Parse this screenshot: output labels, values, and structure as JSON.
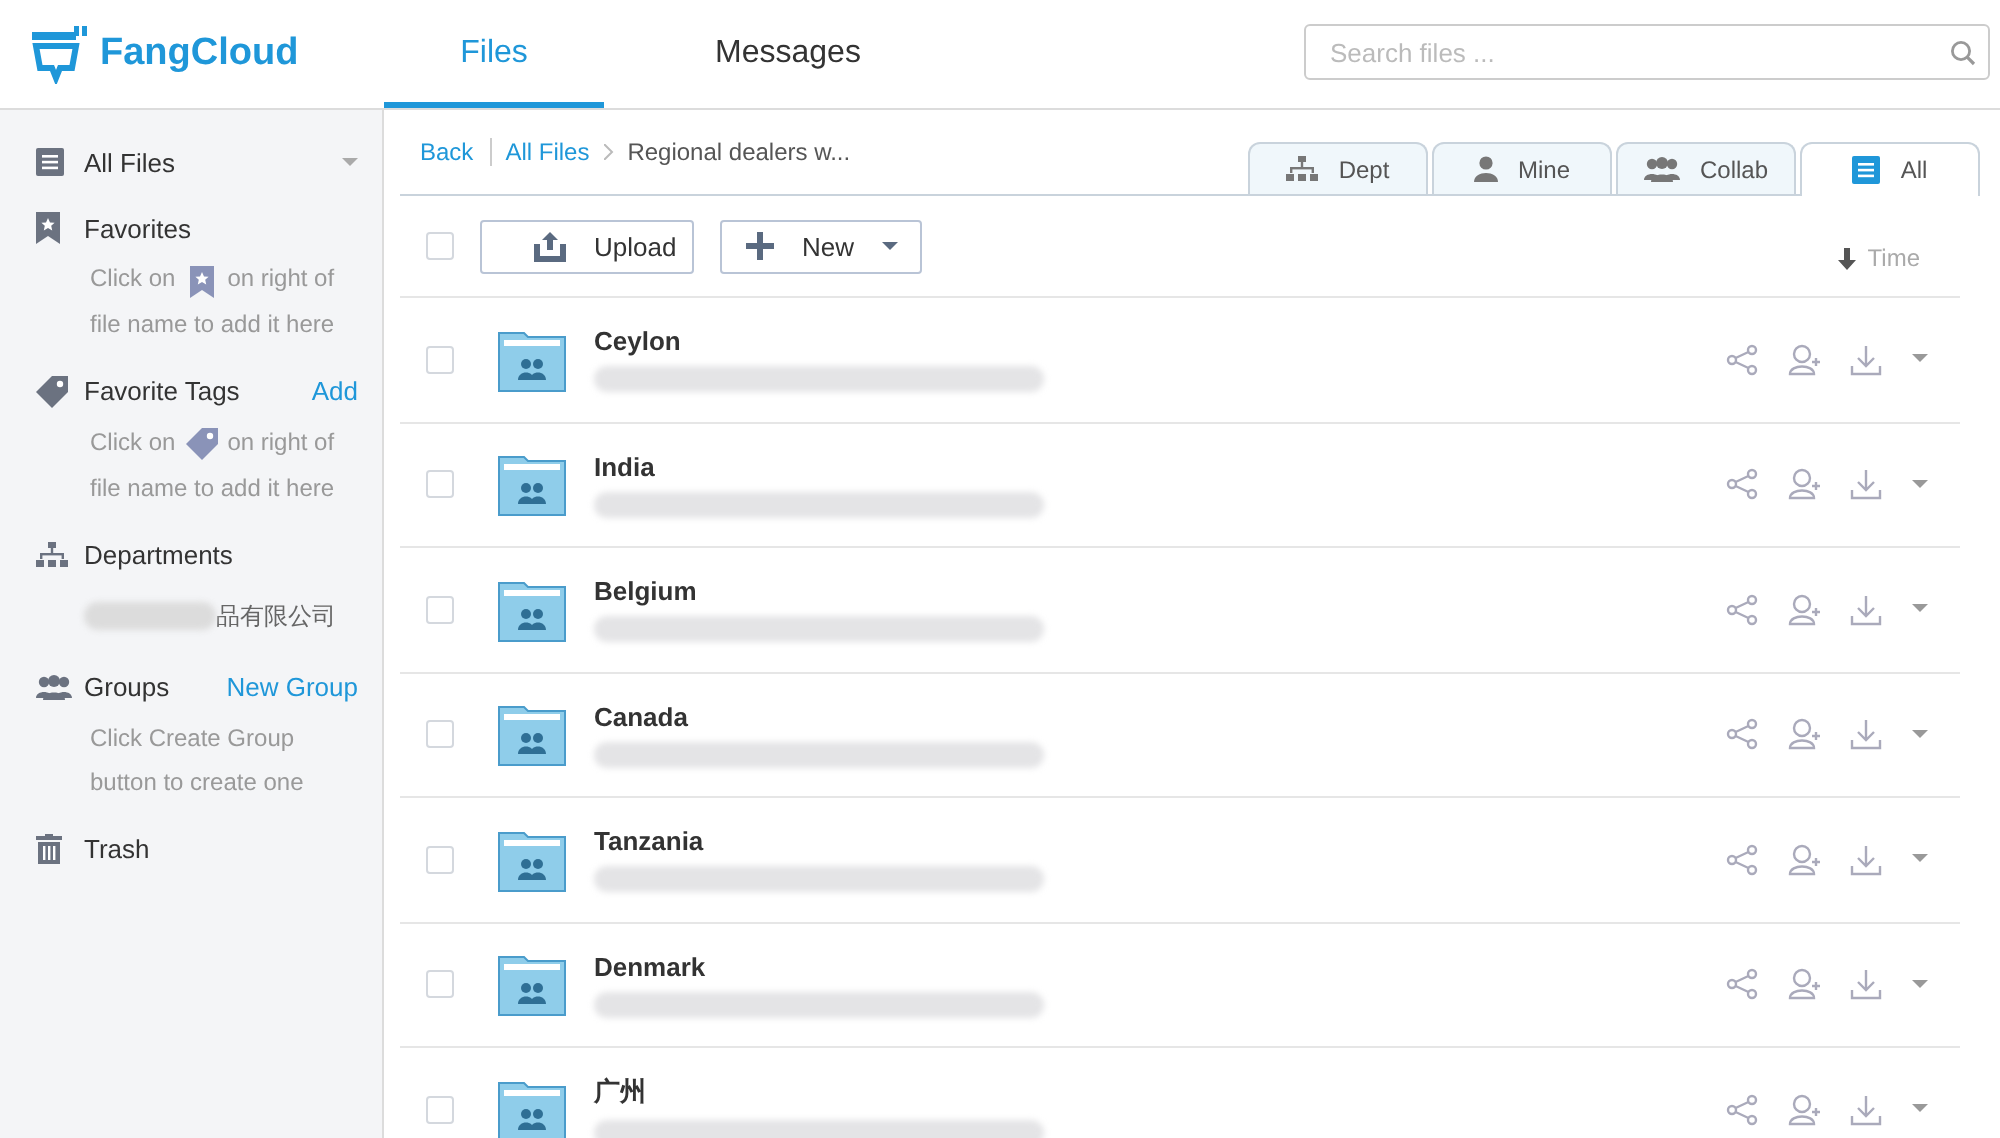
{
  "header": {
    "logo": "FangCloud",
    "tabs": [
      {
        "label": "Files",
        "selected": true
      },
      {
        "label": "Messages",
        "selected": false
      }
    ],
    "search": {
      "placeholder": "Search files ..."
    }
  },
  "sidebar": {
    "items": [
      {
        "label": "All Files"
      },
      {
        "label": "Favorites",
        "hint": {
          "before": "Click on",
          "after": "on right of",
          "line2": "file name to add it here"
        }
      },
      {
        "label": "Favorite Tags",
        "action": "Add",
        "hint": {
          "before": "Click on",
          "after": "on right of",
          "line2": "file name to add it here"
        }
      },
      {
        "label": "Departments",
        "child": "品有限公司"
      },
      {
        "label": "Groups",
        "action": "New Group",
        "hint": {
          "text": "Click Create Group button to create one"
        }
      },
      {
        "label": "Trash"
      }
    ]
  },
  "breadcrumb": {
    "back": "Back",
    "path": [
      "All Files",
      "Regional dealers w..."
    ]
  },
  "view_tabs": [
    {
      "label": "Dept",
      "selected": false
    },
    {
      "label": "Mine",
      "selected": false
    },
    {
      "label": "Collab",
      "selected": false
    },
    {
      "label": "All",
      "selected": true
    }
  ],
  "toolbar": {
    "select_all_checked": false,
    "upload": "Upload",
    "new": "New",
    "sort": "Time"
  },
  "rows": [
    {
      "name": "Ceylon",
      "checked": false
    },
    {
      "name": "India",
      "checked": false
    },
    {
      "name": "Belgium",
      "checked": false
    },
    {
      "name": "Canada",
      "checked": false
    },
    {
      "name": "Tanzania",
      "checked": false
    },
    {
      "name": "Denmark",
      "checked": false
    },
    {
      "name": "广州",
      "checked": false
    }
  ]
}
